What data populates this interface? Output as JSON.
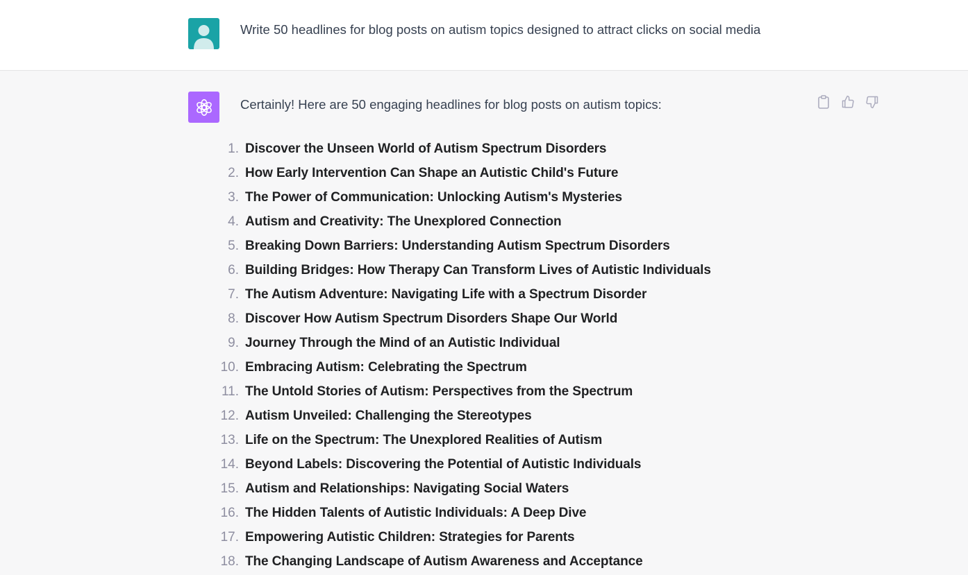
{
  "user": {
    "message": "Write 50 headlines for blog posts on autism topics designed to attract clicks on social media"
  },
  "assistant": {
    "intro": "Certainly! Here are 50 engaging headlines for blog posts on autism topics:",
    "headlines": [
      {
        "num": "1.",
        "text": "Discover the Unseen World of Autism Spectrum Disorders"
      },
      {
        "num": "2.",
        "text": "How Early Intervention Can Shape an Autistic Child's Future"
      },
      {
        "num": "3.",
        "text": "The Power of Communication: Unlocking Autism's Mysteries"
      },
      {
        "num": "4.",
        "text": "Autism and Creativity: The Unexplored Connection"
      },
      {
        "num": "5.",
        "text": "Breaking Down Barriers: Understanding Autism Spectrum Disorders"
      },
      {
        "num": "6.",
        "text": "Building Bridges: How Therapy Can Transform Lives of Autistic Individuals"
      },
      {
        "num": "7.",
        "text": "The Autism Adventure: Navigating Life with a Spectrum Disorder"
      },
      {
        "num": "8.",
        "text": "Discover How Autism Spectrum Disorders Shape Our World"
      },
      {
        "num": "9.",
        "text": "Journey Through the Mind of an Autistic Individual"
      },
      {
        "num": "10.",
        "text": "Embracing Autism: Celebrating the Spectrum"
      },
      {
        "num": "11.",
        "text": "The Untold Stories of Autism: Perspectives from the Spectrum"
      },
      {
        "num": "12.",
        "text": "Autism Unveiled: Challenging the Stereotypes"
      },
      {
        "num": "13.",
        "text": "Life on the Spectrum: The Unexplored Realities of Autism"
      },
      {
        "num": "14.",
        "text": "Beyond Labels: Discovering the Potential of Autistic Individuals"
      },
      {
        "num": "15.",
        "text": "Autism and Relationships: Navigating Social Waters"
      },
      {
        "num": "16.",
        "text": "The Hidden Talents of Autistic Individuals: A Deep Dive"
      },
      {
        "num": "17.",
        "text": "Empowering Autistic Children: Strategies for Parents"
      },
      {
        "num": "18.",
        "text": "The Changing Landscape of Autism Awareness and Acceptance"
      }
    ]
  },
  "icons": {
    "user_avatar": "user-avatar-icon",
    "assistant_avatar": "openai-logo-icon",
    "copy": "clipboard-icon",
    "thumbs_up": "thumbs-up-icon",
    "thumbs_down": "thumbs-down-icon"
  },
  "colors": {
    "user_avatar_bg": "#1aa3a6",
    "assistant_avatar_bg": "#ab68ff",
    "assistant_row_bg": "#f7f7f8"
  }
}
